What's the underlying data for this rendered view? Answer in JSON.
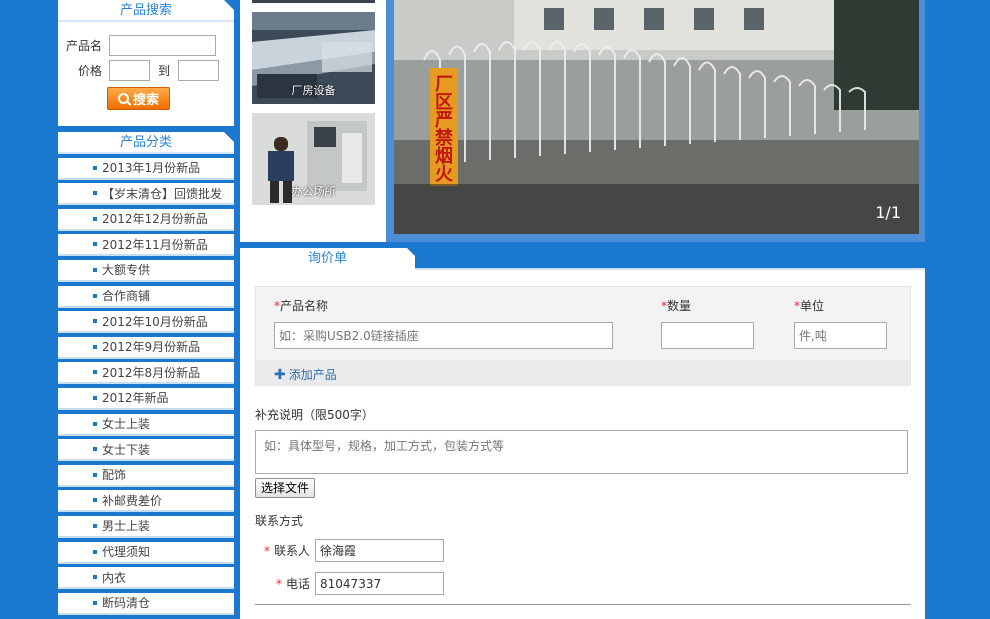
{
  "search": {
    "title": "产品搜索",
    "name_label": "产品名",
    "name_value": "",
    "price_label": "价格",
    "price_min": "",
    "to_label": "到",
    "price_max": "",
    "button_label": "搜索"
  },
  "categories": {
    "title": "产品分类",
    "items": [
      "2013年1月份新品",
      "【岁末清仓】回馈批发",
      "2012年12月份新品",
      "2012年11月份新品",
      "大额专供",
      "合作商铺",
      "2012年10月份新品",
      "2012年9月份新品",
      "2012年8月份新品",
      "2012年新品",
      "女士上装",
      "女士下装",
      "配饰",
      "补邮费差价",
      "男士上装",
      "代理须知",
      "内衣",
      "断码清仓"
    ]
  },
  "thumbs": {
    "items": [
      {
        "caption": "厂房设备"
      },
      {
        "caption": "办公场所"
      }
    ]
  },
  "banner": {
    "counter": "1/1",
    "sign_text": "厂区严禁烟火"
  },
  "inquiry": {
    "tab_label": "询价单",
    "product_name_label": "产品名称",
    "product_name_placeholder": "如：采购USB2.0链接插座",
    "quantity_label": "数量",
    "quantity_value": "",
    "unit_label": "单位",
    "unit_placeholder": "件,吨",
    "add_product_label": "添加产品",
    "remark_label": "补充说明（限500字）",
    "remark_placeholder": "如：具体型号，规格，加工方式，包装方式等",
    "file_button_label": "选择文件",
    "contact_label": "联系方式",
    "contact_person_label": "联系人",
    "contact_person_value": "徐海霞",
    "phone_label": "电话",
    "phone_value": "81047337"
  },
  "colors": {
    "page_bg": "#1a78cf",
    "accent_text": "#2a86d6",
    "button_orange": "#f26d00",
    "required_red": "#ee2233"
  }
}
